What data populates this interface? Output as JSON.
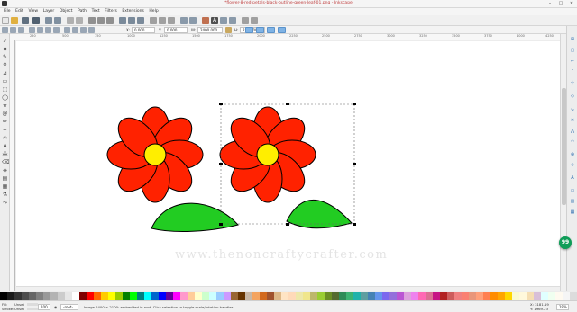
{
  "window": {
    "title": "*flower-8-red-petals-black-outline-green-leaf-01.png - Inkscape",
    "icon": "inkscape-icon",
    "controls": [
      "minimize",
      "maximize",
      "close"
    ]
  },
  "menu": [
    "File",
    "Edit",
    "View",
    "Layer",
    "Object",
    "Path",
    "Text",
    "Filters",
    "Extensions",
    "Help"
  ],
  "controls_bar": {
    "x_label": "X:",
    "x_value": "0.000",
    "y_label": "Y:",
    "y_value": "0.000",
    "w_label": "W:",
    "w_value": "2400.000",
    "h_label": "H:",
    "h_value": "2100.000"
  },
  "ruler_top": [
    "250",
    "500",
    "750",
    "1000",
    "1250",
    "1500",
    "1750",
    "2000",
    "2250",
    "2500",
    "2750",
    "3000",
    "3250",
    "3500",
    "3750",
    "4000",
    "4250"
  ],
  "watermark": "www.thenoncraftycrafter.com",
  "fab_label": "99",
  "status": {
    "fill_label": "Fill:",
    "fill_value": "Unset",
    "stroke_label": "Stroke:",
    "stroke_value": "Unset",
    "opacity_value": "100",
    "layer_value": "-root-",
    "message": "Image 2400 × 2100: embedded in root. Click selection to toggle scale/rotation handles.",
    "cursor_x": "X: 3181.19",
    "cursor_y": "Y: 1969.23",
    "zoom": "19%"
  },
  "colors": {
    "petal": "#ff2200",
    "center": "#ffee00",
    "leaf": "#22cc22",
    "fab": "#0f9d58"
  },
  "palette": [
    "#000000",
    "#1a1a1a",
    "#333333",
    "#4d4d4d",
    "#666666",
    "#808080",
    "#999999",
    "#b3b3b3",
    "#cccccc",
    "#e6e6e6",
    "#ffffff",
    "#800000",
    "#ff0000",
    "#ff6600",
    "#ffcc00",
    "#ffff00",
    "#99cc00",
    "#008000",
    "#00ff00",
    "#008080",
    "#00ffff",
    "#0066cc",
    "#0000ff",
    "#660099",
    "#ff00ff",
    "#ff99cc",
    "#ffcc99",
    "#ffffcc",
    "#ccffcc",
    "#ccffff",
    "#99ccff",
    "#cc99ff",
    "#996633",
    "#663300",
    "#c8b7a6",
    "#f4a460",
    "#d2691e",
    "#a0522d",
    "#deb887",
    "#ffe4c4",
    "#ffdab9",
    "#eee8aa",
    "#f0e68c",
    "#bdb76b",
    "#9acd32",
    "#6b8e23",
    "#556b2f",
    "#2e8b57",
    "#3cb371",
    "#20b2aa",
    "#5f9ea0",
    "#4682b4",
    "#6495ed",
    "#7b68ee",
    "#9370db",
    "#ba55d3",
    "#dda0dd",
    "#ee82ee",
    "#ff69b4",
    "#db7093",
    "#c71585",
    "#b22222",
    "#cd5c5c",
    "#f08080",
    "#fa8072",
    "#e9967a",
    "#ffa07a",
    "#ff7f50",
    "#ff8c00",
    "#ffa500",
    "#ffd700",
    "#fafad2",
    "#fff8dc",
    "#f5deb3",
    "#d8bfd8",
    "#e0ffff",
    "#f0fff0",
    "#fffaf0",
    "#f5f5f5",
    "#dcdcdc"
  ]
}
